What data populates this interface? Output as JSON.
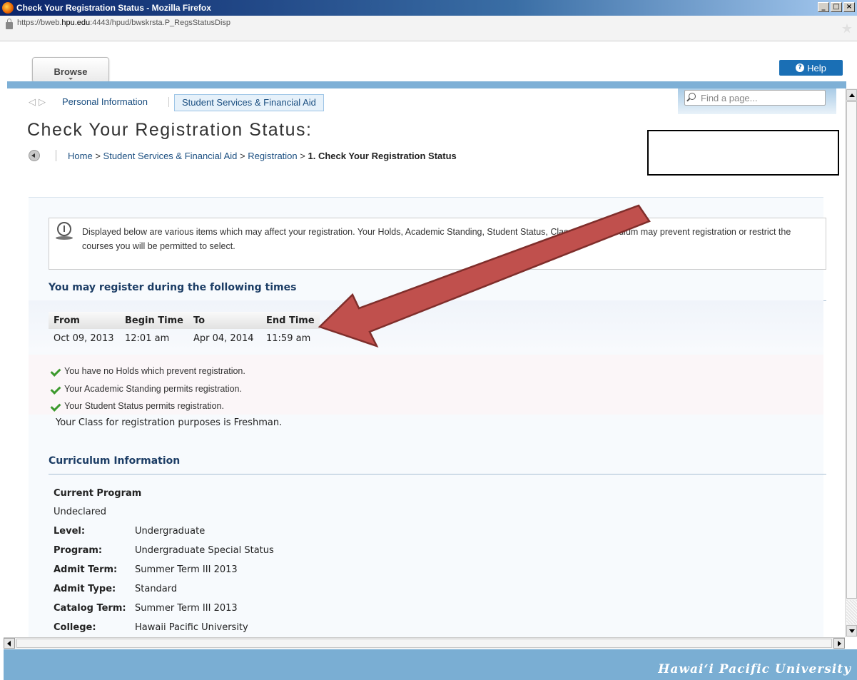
{
  "window": {
    "title": "Check Your Registration Status - Mozilla Firefox",
    "url_prefix": "https://bweb.",
    "url_domain": "hpu.edu",
    "url_suffix": ":4443/hpud/bwskrsta.P_RegsStatusDisp"
  },
  "header": {
    "browse_label": "Browse",
    "help_label": "Help",
    "find_placeholder": "Find a page..."
  },
  "nav": {
    "tab_personal": "Personal Information",
    "tab_student": "Student Services & Financial Aid"
  },
  "page_title": "Check Your Registration Status:",
  "breadcrumb": {
    "home": "Home",
    "sep": ">",
    "services": "Student Services & Financial Aid",
    "registration": "Registration",
    "current": "1. Check Your Registration Status"
  },
  "notice": "Displayed below are various items which may affect your registration. Your Holds, Academic Standing, Student Status, Class, and Curriculum may prevent registration or restrict the courses you will be permitted to select.",
  "times": {
    "heading": "You may register during the following times",
    "columns": [
      "From",
      "Begin Time",
      "To",
      "End Time"
    ],
    "row": [
      "Oct 09, 2013",
      "12:01 am",
      "Apr 04, 2014",
      "11:59 am"
    ]
  },
  "status": {
    "holds": "You have no Holds which prevent registration.",
    "academic": "Your Academic Standing permits registration.",
    "student": "Your Student Status permits registration.",
    "class_line": "Your Class for registration purposes is Freshman."
  },
  "curriculum": {
    "heading": "Curriculum Information",
    "current_program_label": "Current Program",
    "current_program_value": "Undeclared",
    "rows": [
      {
        "k": "Level:",
        "v": "Undergraduate"
      },
      {
        "k": "Program:",
        "v": "Undergraduate Special Status"
      },
      {
        "k": "Admit Term:",
        "v": "Summer Term III 2013"
      },
      {
        "k": "Admit Type:",
        "v": "Standard"
      },
      {
        "k": "Catalog Term:",
        "v": "Summer Term III 2013"
      },
      {
        "k": "College:",
        "v": "Hawaii Pacific University"
      }
    ]
  },
  "footer": {
    "brand": "Hawai‘i Pacific University"
  },
  "colors": {
    "accent_blue": "#1a6fb5",
    "heading_navy": "#1c3d65",
    "arrow_red": "#c0504d",
    "footer_blue": "#7aaed3"
  },
  "icons": {
    "check": "check-icon",
    "info": "info-icon",
    "back": "back-arrow-icon",
    "search": "search-icon",
    "help": "help-icon"
  }
}
